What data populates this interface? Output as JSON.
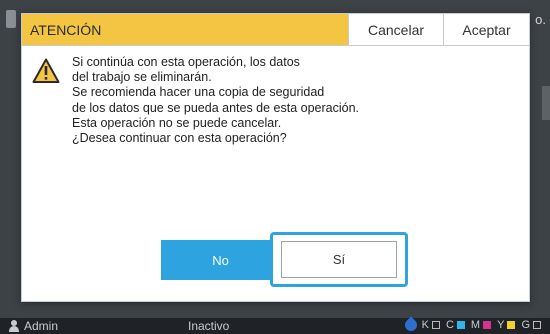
{
  "background": {
    "top_right_text": "o.",
    "status": {
      "user": "Admin",
      "state": "Inactivo",
      "inks": [
        {
          "label": "K",
          "color": "#ffffff"
        },
        {
          "label": "C",
          "color": "#2fb5e8"
        },
        {
          "label": "M",
          "color": "#d6338f"
        },
        {
          "label": "Y",
          "color": "#f2d02c"
        },
        {
          "label": "G",
          "color": "#ffffff"
        }
      ]
    }
  },
  "dialog": {
    "title": "ATENCIÓN",
    "cancel_label": "Cancelar",
    "accept_label": "Aceptar",
    "message_lines": [
      "Si continúa con esta operación, los datos",
      "del trabajo se eliminarán.",
      "Se recomienda hacer una copia de seguridad",
      "de los datos que se pueda antes de esta operación.",
      "Esta operación no se puede cancelar.",
      "¿Desea continuar con esta operación?"
    ],
    "no_label": "No",
    "yes_label": "Sí",
    "icon": "warning-icon"
  },
  "colors": {
    "header_accent": "#f4c542",
    "primary_button": "#2da3e0",
    "focus_ring": "#2da3e0"
  }
}
